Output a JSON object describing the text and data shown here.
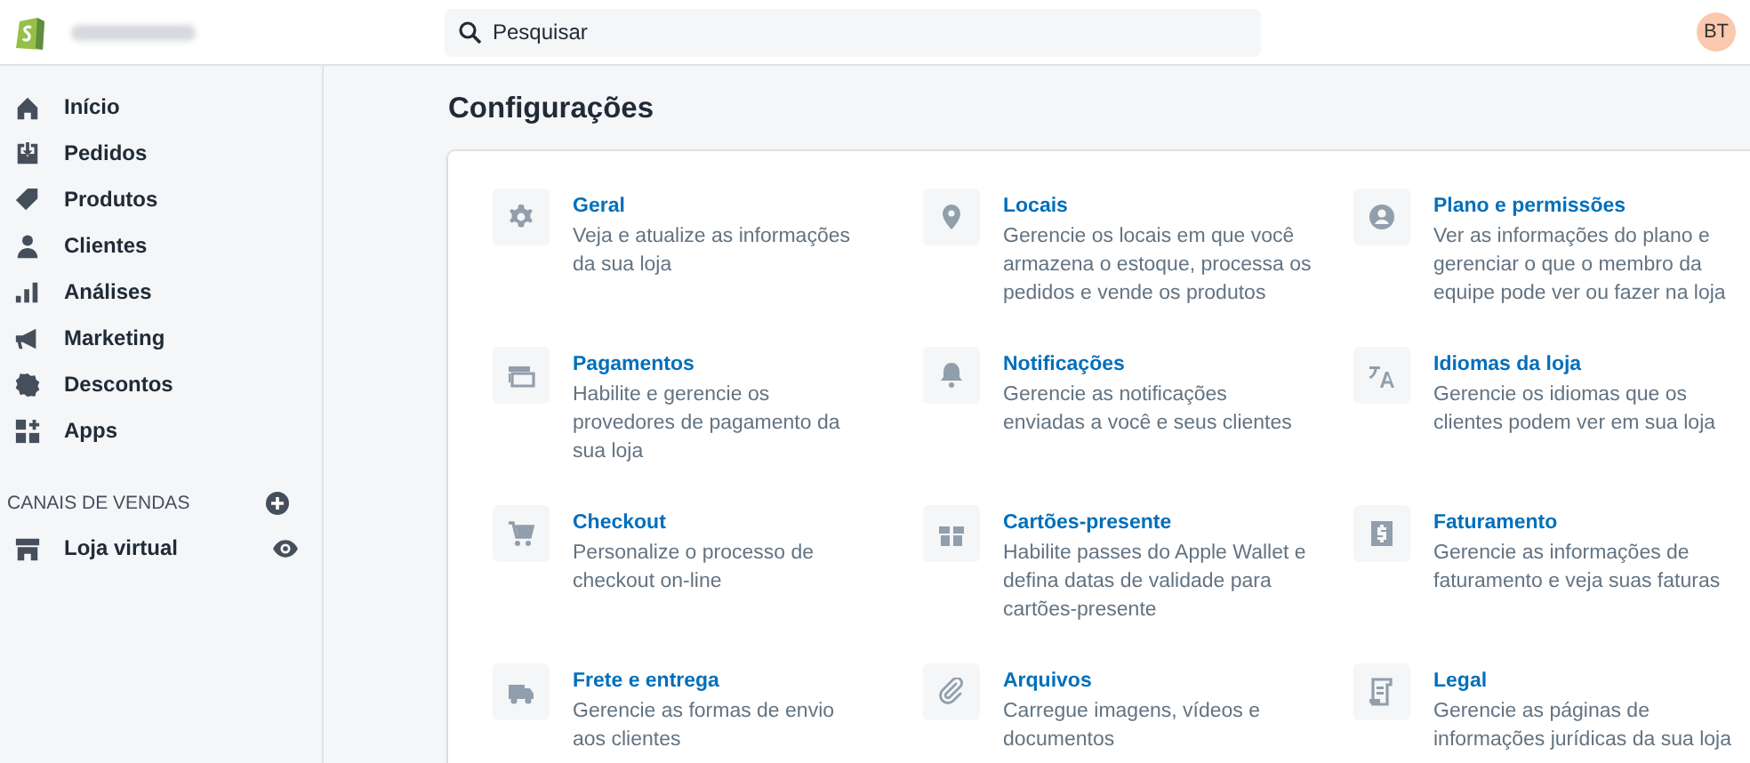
{
  "topbar": {
    "search": {
      "placeholder": "Pesquisar"
    },
    "avatar": "BT"
  },
  "sidebar": {
    "items": [
      {
        "label": "Início",
        "selected": false
      },
      {
        "label": "Pedidos",
        "selected": false
      },
      {
        "label": "Produtos",
        "selected": false
      },
      {
        "label": "Clientes",
        "selected": false
      },
      {
        "label": "Análises",
        "selected": false
      },
      {
        "label": "Marketing",
        "selected": false
      },
      {
        "label": "Descontos",
        "selected": false
      },
      {
        "label": "Apps",
        "selected": false
      }
    ],
    "section_title": "CANAIS DE VENDAS",
    "channels": [
      {
        "label": "Loja virtual"
      }
    ]
  },
  "page_title": "Configurações",
  "settings": [
    {
      "title": "Geral",
      "description": "Veja e atualize as informações da sua loja"
    },
    {
      "title": "Locais",
      "description": "Gerencie os locais em que você armazena o estoque, processa os pedidos e vende os produtos"
    },
    {
      "title": "Plano e permissões",
      "description": "Ver as informações do plano e gerenciar o que o membro da equipe pode ver ou fazer na loja"
    },
    {
      "title": "Pagamentos",
      "description": "Habilite e gerencie os provedores de pagamento da sua loja"
    },
    {
      "title": "Notificações",
      "description": "Gerencie as notificações enviadas a você e seus clientes"
    },
    {
      "title": "Idiomas da loja",
      "description": "Gerencie os idiomas que os clientes podem ver em sua loja"
    },
    {
      "title": "Checkout",
      "description": "Personalize o processo de checkout on-line"
    },
    {
      "title": "Cartões-presente",
      "description": "Habilite passes do Apple Wallet e defina datas de validade para cartões-presente"
    },
    {
      "title": "Faturamento",
      "description": "Gerencie as informações de faturamento e veja suas faturas"
    },
    {
      "title": "Frete e entrega",
      "description": "Gerencie as formas de envio aos clientes"
    },
    {
      "title": "Arquivos",
      "description": "Carregue imagens, vídeos e documentos"
    },
    {
      "title": "Legal",
      "description": "Gerencie as páginas de informações jurídicas da sua loja"
    }
  ]
}
